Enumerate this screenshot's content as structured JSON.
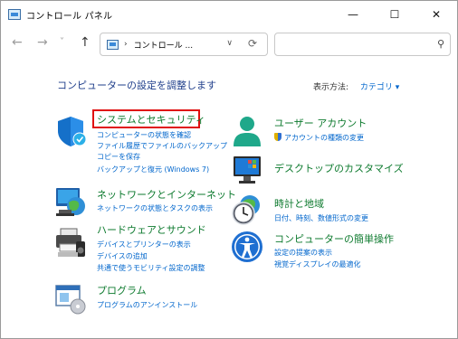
{
  "window": {
    "title": "コントロール パネル",
    "minimize_glyph": "—",
    "maximize_glyph": "☐",
    "close_glyph": "✕"
  },
  "nav": {
    "back_glyph": "←",
    "forward_glyph": "→",
    "recent_glyph": "˅",
    "up_glyph": "↑",
    "address_separator": "›",
    "address_text": "コントロール ...",
    "address_dropdown_glyph": "∨",
    "refresh_glyph": "⟳",
    "search_placeholder": "",
    "search_glyph": "⚲"
  },
  "page": {
    "heading": "コンピューターの設定を調整します",
    "view_by_label": "表示方法:",
    "view_by_value": "カテゴリ ▾"
  },
  "left_categories": [
    {
      "title": "システムとセキュリティ",
      "icon": "shield-icon",
      "links": [
        "コンピューターの状態を確認",
        "ファイル履歴でファイルのバックアップ コピーを保存",
        "バックアップと復元 (Windows 7)"
      ]
    },
    {
      "title": "ネットワークとインターネット",
      "icon": "network-globe-icon",
      "links": [
        "ネットワークの状態とタスクの表示"
      ]
    },
    {
      "title": "ハードウェアとサウンド",
      "icon": "printer-speaker-icon",
      "links": [
        "デバイスとプリンターの表示",
        "デバイスの追加",
        "共通で使うモビリティ設定の調整"
      ]
    },
    {
      "title": "プログラム",
      "icon": "programs-icon",
      "links": [
        "プログラムのアンインストール"
      ]
    }
  ],
  "left_link_lines": {
    "system_line2": "ファイル履歴でファイルのバックアップ",
    "system_line3": "コピーを保存"
  },
  "right_categories": [
    {
      "title": "ユーザー アカウント",
      "icon": "user-icon",
      "links": [
        "アカウントの種類の変更"
      ]
    },
    {
      "title": "デスクトップのカスタマイズ",
      "icon": "desktop-icon",
      "links": []
    },
    {
      "title": "時計と地域",
      "icon": "clock-globe-icon",
      "links": [
        "日付、時刻、数値形式の変更"
      ]
    },
    {
      "title": "コンピューターの簡単操作",
      "icon": "accessibility-icon",
      "links": [
        "設定の提案の表示",
        "視覚ディスプレイの最適化"
      ]
    }
  ],
  "colors": {
    "category_title": "#0d7a2e",
    "link": "#0066cc",
    "heading": "#1e3d8a",
    "highlight_border": "#e01010"
  }
}
